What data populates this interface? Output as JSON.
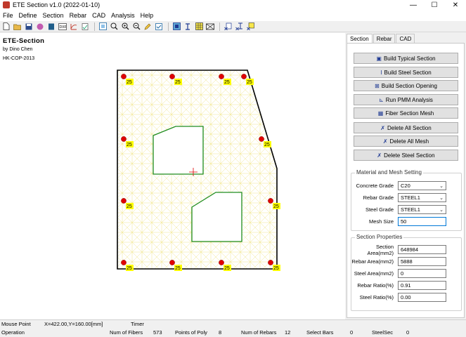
{
  "window": {
    "title": "ETE Section v1.0 (2022-01-10)",
    "minimize": "—",
    "maximize": "☐",
    "close": "✕"
  },
  "menu": [
    "File",
    "Define",
    "Section",
    "Rebar",
    "CAD",
    "Analysis",
    "Help"
  ],
  "canvas": {
    "title": "ETE-Section",
    "author": "by Dino Chen",
    "code": "HK-COP-2013",
    "rebar_label": "25",
    "colors": {
      "outline": "#000000",
      "opening": "#1e8c1e",
      "rebar": "#e00000",
      "label_bg": "#ffff00",
      "mesh": "#f0e68c",
      "cross": "#e00000"
    }
  },
  "tabs": [
    "Section",
    "Rebar",
    "CAD"
  ],
  "actions": [
    {
      "label": "Build Typical Section",
      "icon": "▣"
    },
    {
      "label": "Build Steel Section",
      "icon": "I"
    },
    {
      "label": "Build Section Opening",
      "icon": "⊠"
    },
    {
      "label": "Run PMM Analysis",
      "icon": "⊾"
    },
    {
      "label": "Fiber Section Mesh",
      "icon": "▦"
    },
    {
      "label": "Delete All Section",
      "icon": "✗"
    },
    {
      "label": "Delete All Mesh",
      "icon": "✗"
    },
    {
      "label": "Delete Steel Section",
      "icon": "✗"
    }
  ],
  "material": {
    "title": "Material and Mesh Setting",
    "concrete_label": "Concrete Grade",
    "concrete_value": "C20",
    "rebar_label": "Rebar Grade",
    "rebar_value": "STEEL1",
    "steel_label": "Steel Grade",
    "steel_value": "STEEL1",
    "mesh_label": "Mesh Size",
    "mesh_value": "50"
  },
  "properties": {
    "title": "Section Properties",
    "area_label": "Section Area(mm2)",
    "area_value": "648984",
    "rebar_area_label": "Rebar Area(mm2)",
    "rebar_area_value": "5888",
    "steel_area_label": "Steel Area(mm2)",
    "steel_area_value": "0",
    "rebar_ratio_label": "Rebar Ratio(%)",
    "rebar_ratio_value": "0.91",
    "steel_ratio_label": "Steel Ratio(%)",
    "steel_ratio_value": "0.00"
  },
  "status": {
    "mouse_label": "Mouse Point",
    "mouse_value": "X=422.00,Y=160.00[mm]",
    "timer_label": "Timer",
    "operation_label": "Operation",
    "fibers_label": "Num of Fibers",
    "fibers_value": "573",
    "poly_label": "Points of Poly",
    "poly_value": "8",
    "rebars_label": "Num of Rebars",
    "rebars_value": "12",
    "select_label": "Select Bars",
    "select_value": "0",
    "steelsec_label": "SteelSec",
    "steelsec_value": "0"
  }
}
